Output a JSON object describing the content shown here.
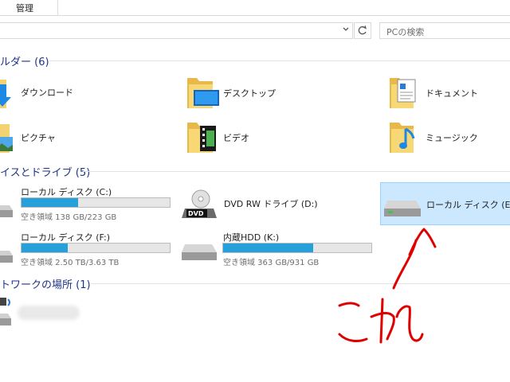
{
  "ribbon": {
    "tab_manage": "管理"
  },
  "search": {
    "placeholder": "PCの検索"
  },
  "sections": {
    "folders": "ルダー (6)",
    "devices": "イスとドライブ (5)",
    "network": "トワークの場所 (1)"
  },
  "folders": [
    {
      "label": "ダウンロード",
      "icon": "download-folder-icon"
    },
    {
      "label": "デスクトップ",
      "icon": "desktop-folder-icon"
    },
    {
      "label": "ドキュメント",
      "icon": "documents-folder-icon"
    },
    {
      "label": "ピクチャ",
      "icon": "pictures-folder-icon"
    },
    {
      "label": "ビデオ",
      "icon": "videos-folder-icon"
    },
    {
      "label": "ミュージック",
      "icon": "music-folder-icon"
    }
  ],
  "drives": [
    {
      "label": "ローカル ディスク (C:)",
      "space": "空き領域 138 GB/223 GB",
      "used_fraction": 0.38
    },
    {
      "label": "DVD RW ドライブ (D:)"
    },
    {
      "label": "ローカル ディスク (E:)",
      "selected": true
    },
    {
      "label": "ローカル ディスク (F:)",
      "space": "空き領域 2.50 TB/3.63 TB",
      "used_fraction": 0.31
    },
    {
      "label": "内蔵HDD (K:)",
      "space": "空き領域 363 GB/931 GB",
      "used_fraction": 0.61
    }
  ],
  "annotation": {
    "text": "これ",
    "color": "#e00000"
  },
  "colors": {
    "accent": "#26a0da",
    "selection": "#cce8ff",
    "section_title": "#1e3287"
  }
}
